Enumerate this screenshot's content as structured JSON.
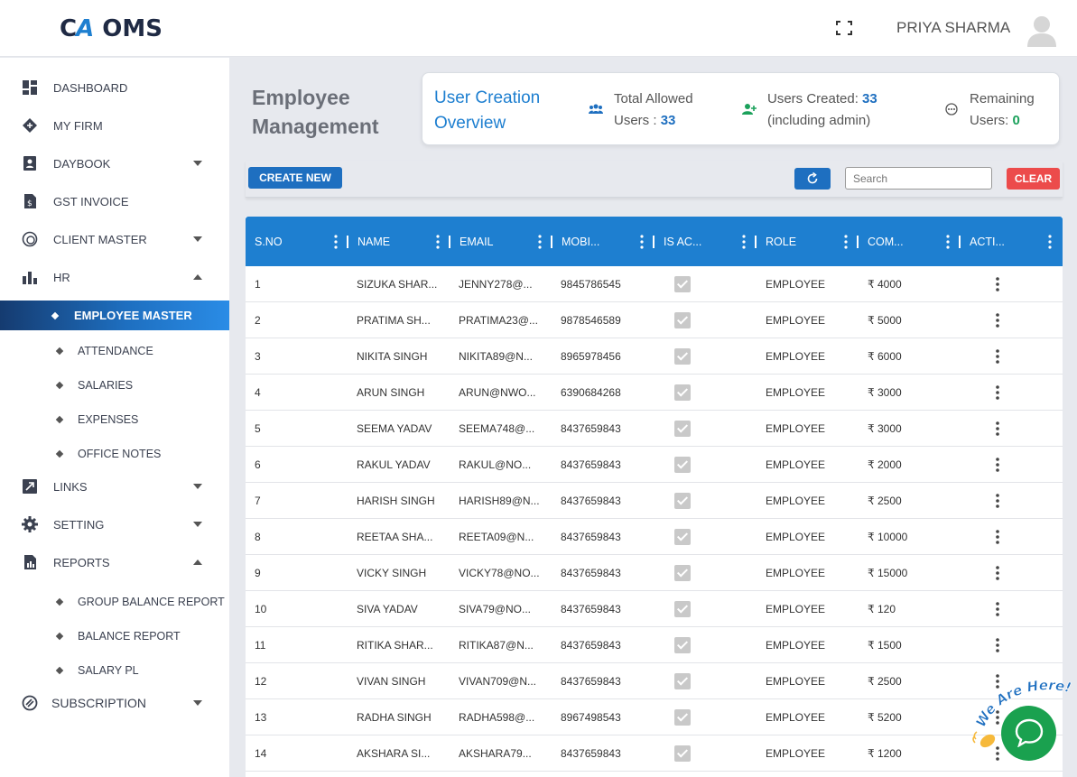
{
  "header": {
    "logo_mark_c": "C",
    "logo_mark_a": "A",
    "logo_text": "OMS",
    "user_name": "PRIYA SHARMA"
  },
  "sidebar": {
    "items": [
      {
        "label": "DASHBOARD",
        "icon": "dashboard-icon"
      },
      {
        "label": "MY FIRM",
        "icon": "firm-icon"
      },
      {
        "label": "DAYBOOK",
        "icon": "daybook-icon"
      },
      {
        "label": "GST INVOICE",
        "icon": "invoice-icon"
      },
      {
        "label": "CLIENT MASTER",
        "icon": "client-icon"
      },
      {
        "label": "HR",
        "icon": "hr-icon"
      },
      {
        "label": "LINKS",
        "icon": "links-icon"
      },
      {
        "label": "SETTING",
        "icon": "gear-icon"
      },
      {
        "label": "REPORTS",
        "icon": "reports-icon"
      },
      {
        "label": "SUBSCRIPTION",
        "icon": "subscription-icon"
      }
    ],
    "hr_sub": [
      "EMPLOYEE MASTER",
      "ATTENDANCE",
      "SALARIES",
      "EXPENSES",
      "OFFICE NOTES"
    ],
    "reports_sub": [
      "GROUP BALANCE REPORT",
      "BALANCE REPORT",
      "SALARY PL"
    ]
  },
  "page": {
    "title": "Employee Management"
  },
  "overview": {
    "title": "User Creation Overview",
    "total_label": "Total Allowed",
    "total_label2": "Users : ",
    "total_value": "33",
    "created_label": "Users Created: ",
    "created_value": "33",
    "created_note": "(including admin)",
    "remaining_label": "Remaining",
    "remaining_label2": "Users: ",
    "remaining_value": "0"
  },
  "toolbar": {
    "create_label": "CREATE NEW",
    "search_placeholder": "Search",
    "clear_label": "CLEAR"
  },
  "table": {
    "columns": [
      "S.NO",
      "NAME",
      "EMAIL",
      "MOBI...",
      "IS AC...",
      "ROLE",
      "COM...",
      "ACTI..."
    ],
    "rows": [
      {
        "sno": "1",
        "name": "SIZUKA SHAR...",
        "email": "JENNY278@...",
        "mobile": "9845786545",
        "role": "EMPLOYEE",
        "com": "₹ 4000"
      },
      {
        "sno": "2",
        "name": "PRATIMA SH...",
        "email": "PRATIMA23@...",
        "mobile": "9878546589",
        "role": "EMPLOYEE",
        "com": "₹ 5000"
      },
      {
        "sno": "3",
        "name": "NIKITA SINGH",
        "email": "NIKITA89@N...",
        "mobile": "8965978456",
        "role": "EMPLOYEE",
        "com": "₹ 6000"
      },
      {
        "sno": "4",
        "name": "ARUN SINGH",
        "email": "ARUN@NWO...",
        "mobile": "6390684268",
        "role": "EMPLOYEE",
        "com": "₹ 3000"
      },
      {
        "sno": "5",
        "name": "SEEMA YADAV",
        "email": "SEEMA748@...",
        "mobile": "8437659843",
        "role": "EMPLOYEE",
        "com": "₹ 3000"
      },
      {
        "sno": "6",
        "name": "RAKUL YADAV",
        "email": "RAKUL@NO...",
        "mobile": "8437659843",
        "role": "EMPLOYEE",
        "com": "₹ 2000"
      },
      {
        "sno": "7",
        "name": "HARISH SINGH",
        "email": "HARISH89@N...",
        "mobile": "8437659843",
        "role": "EMPLOYEE",
        "com": "₹ 2500"
      },
      {
        "sno": "8",
        "name": "REETAA SHA...",
        "email": "REETA09@N...",
        "mobile": "8437659843",
        "role": "EMPLOYEE",
        "com": "₹ 10000"
      },
      {
        "sno": "9",
        "name": "VICKY SINGH",
        "email": "VICKY78@NO...",
        "mobile": "8437659843",
        "role": "EMPLOYEE",
        "com": "₹ 15000"
      },
      {
        "sno": "10",
        "name": "SIVA YADAV",
        "email": "SIVA79@NO...",
        "mobile": "8437659843",
        "role": "EMPLOYEE",
        "com": "₹ 120"
      },
      {
        "sno": "11",
        "name": "RITIKA SHAR...",
        "email": "RITIKA87@N...",
        "mobile": "8437659843",
        "role": "EMPLOYEE",
        "com": "₹ 1500"
      },
      {
        "sno": "12",
        "name": "VIVAN SINGH",
        "email": "VIVAN709@N...",
        "mobile": "8437659843",
        "role": "EMPLOYEE",
        "com": "₹ 2500"
      },
      {
        "sno": "13",
        "name": "RADHA SINGH",
        "email": "RADHA598@...",
        "mobile": "8967498543",
        "role": "EMPLOYEE",
        "com": "₹ 5200"
      },
      {
        "sno": "14",
        "name": "AKSHARA SI...",
        "email": "AKSHARA79...",
        "mobile": "8437659843",
        "role": "EMPLOYEE",
        "com": "₹ 1200"
      }
    ]
  },
  "chat": {
    "tag_text": "We Are Here!"
  },
  "colors": {
    "primary": "#1e6fc0",
    "header_blue": "#1e7fd0",
    "clear_red": "#ec4b4b",
    "chat_green": "#1aa14f"
  }
}
